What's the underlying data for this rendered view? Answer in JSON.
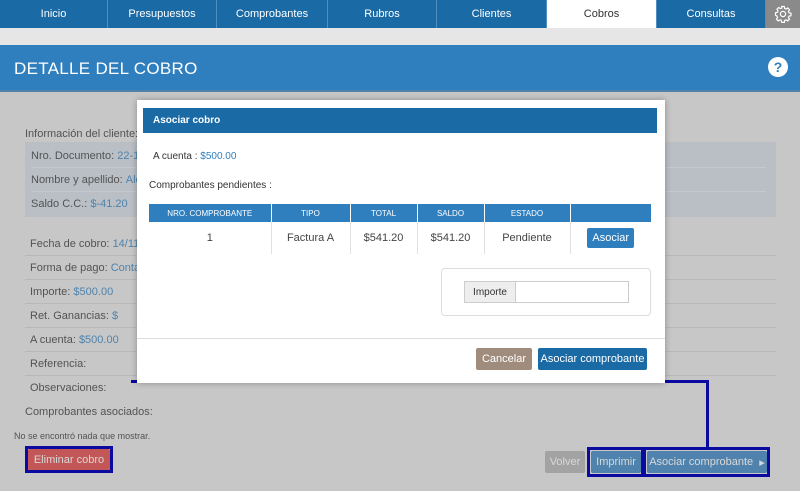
{
  "nav": {
    "items": [
      {
        "label": "Inicio",
        "width": 108
      },
      {
        "label": "Presupuestos",
        "width": 109
      },
      {
        "label": "Comprobantes",
        "width": 111
      },
      {
        "label": "Rubros",
        "width": 109
      },
      {
        "label": "Clientes",
        "width": 110
      },
      {
        "label": "Cobros",
        "width": 110,
        "active": true
      },
      {
        "label": "Consultas",
        "width": 109
      }
    ],
    "settings_icon": "gear-icon"
  },
  "header": {
    "title": "DETALLE DEL COBRO",
    "help_icon": "question-icon",
    "help_symbol": "?"
  },
  "client": {
    "section_label": "Información del cliente:",
    "doc_label": "Nro. Documento:",
    "doc_value": "22-12",
    "name_label": "Nombre y apellido:",
    "name_value": "Ale",
    "balance_label": "Saldo C.C.:",
    "balance_value": "$-41.20"
  },
  "fields": {
    "fecha_label": "Fecha de cobro:",
    "fecha_value": "14/11/",
    "forma_label": "Forma de pago:",
    "forma_value": "Conta",
    "importe_label": "Importe:",
    "importe_value": "$500.00",
    "ret_label": "Ret. Ganancias:",
    "ret_value": "$",
    "cuenta_label": "A cuenta:",
    "cuenta_value": "$500.00",
    "referencia_label": "Referencia:",
    "observaciones_label": "Observaciones:"
  },
  "associated": {
    "label": "Comprobantes asociados:",
    "empty_text": "No se encontró nada que mostrar."
  },
  "buttons": {
    "eliminar": "Eliminar cobro",
    "volver": "Volver",
    "imprimir": "Imprimir",
    "asociar": "Asociar comprobante",
    "asociar_arrow": "▸"
  },
  "modal": {
    "title": "Asociar cobro",
    "a_cuenta_label": "A cuenta :",
    "a_cuenta_value": "$500.00",
    "pendientes_label": "Comprobantes pendientes :",
    "columns": [
      "NRO. COMPROBANTE",
      "TIPO",
      "TOTAL",
      "SALDO",
      "ESTADO"
    ],
    "rows": [
      {
        "nro": "1",
        "tipo": "Factura A",
        "total": "$541.20",
        "saldo": "$541.20",
        "estado": "Pendiente",
        "action": "Asociar"
      }
    ],
    "importe_label": "Importe",
    "importe_value": "",
    "cancel": "Cancelar",
    "submit": "Asociar comprobante"
  },
  "colors": {
    "primary": "#1a6aa6",
    "accent": "#2f7fbf",
    "danger": "#e03a3a",
    "cancel": "#a08c7c",
    "disabled": "#b0b0b0"
  }
}
